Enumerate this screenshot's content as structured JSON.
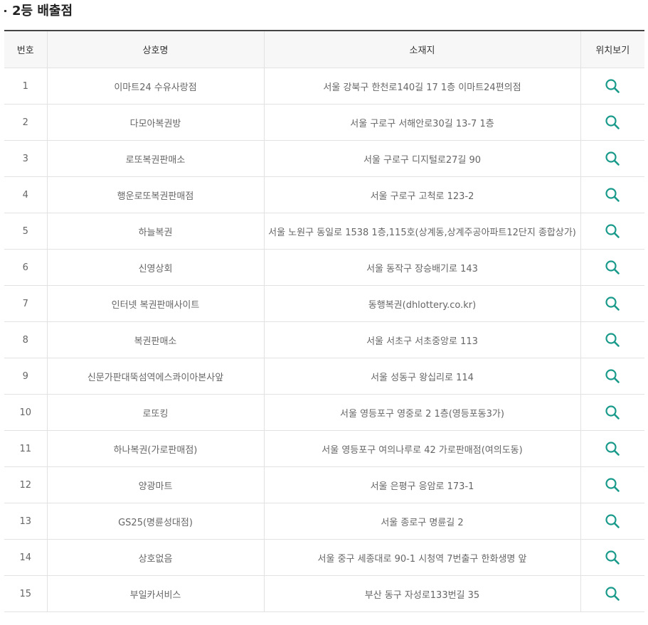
{
  "title": "2등 배출점",
  "table": {
    "headers": {
      "no": "번호",
      "name": "상호명",
      "address": "소재지",
      "location": "위치보기"
    },
    "rows": [
      {
        "no": "1",
        "name": "이마트24 수유사랑점",
        "address": "서울 강북구 한천로140길 17 1층 이마트24편의점"
      },
      {
        "no": "2",
        "name": "다모아복권방",
        "address": "서울 구로구 서해안로30길 13-7 1층"
      },
      {
        "no": "3",
        "name": "로또복권판매소",
        "address": "서울 구로구 디지털로27길 90"
      },
      {
        "no": "4",
        "name": "행운로또복권판매점",
        "address": "서울 구로구 고척로 123-2"
      },
      {
        "no": "5",
        "name": "하늘복권",
        "address": "서울 노원구 동일로 1538 1층,115호(상계동,상계주공아파트12단지 종합상가)"
      },
      {
        "no": "6",
        "name": "신영상회",
        "address": "서울 동작구 장승배기로 143"
      },
      {
        "no": "7",
        "name": "인터넷 복권판매사이트",
        "address": "동행복권(dhlottery.co.kr)"
      },
      {
        "no": "8",
        "name": "복권판매소",
        "address": "서울 서초구 서초중앙로 113"
      },
      {
        "no": "9",
        "name": "신문가판대뚝섬역에스콰이아본사앞",
        "address": "서울 성동구 왕십리로 114"
      },
      {
        "no": "10",
        "name": "로또킹",
        "address": "서울 영등포구 영중로 2 1층(영등포동3가)"
      },
      {
        "no": "11",
        "name": "하나복권(가로판매점)",
        "address": "서울 영등포구 여의나루로 42 가로판매점(여의도동)"
      },
      {
        "no": "12",
        "name": "양광마트",
        "address": "서울 은평구 응암로 173-1"
      },
      {
        "no": "13",
        "name": "GS25(명륜성대점)",
        "address": "서울 종로구 명륜길 2"
      },
      {
        "no": "14",
        "name": "상호없음",
        "address": "서울 중구 세종대로 90-1 시청역 7번출구 한화생명 앞"
      },
      {
        "no": "15",
        "name": "부일카서비스",
        "address": "부산 동구 자성로133번길 35"
      }
    ]
  },
  "icons": {
    "location": "search-icon"
  },
  "colors": {
    "icon": "#1a9a8a",
    "header_border": "#444444",
    "header_bg": "#f7f7f7"
  }
}
